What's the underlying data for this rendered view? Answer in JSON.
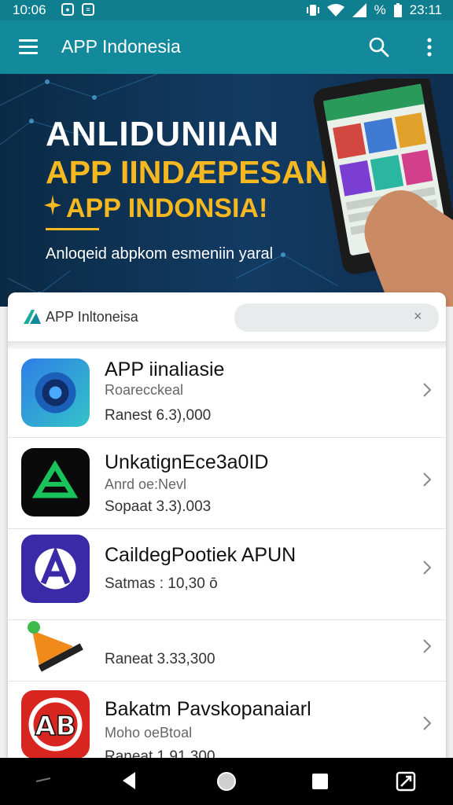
{
  "status_bar": {
    "time": "10:06",
    "battery": "%",
    "clock_right": "23:11"
  },
  "app_bar": {
    "title": "APP Indonesia"
  },
  "banner": {
    "line1": "ANLIDUNIIAN",
    "line2": "APP IINDÆPESAN",
    "line3": "APP INDONSIA!",
    "tagline": "Anloqeid abpkom esmeniin yaral"
  },
  "card": {
    "brand": "APP Inltoneisa",
    "search_placeholder": "",
    "clear_label": "×"
  },
  "apps": [
    {
      "title": "APP iinaliasie",
      "subtitle": "Roarecckeal",
      "price": "Ranest 6.3),000"
    },
    {
      "title": "UnkatignEce3a0ID",
      "subtitle": "Anrd oe:Nevl",
      "price": "Sopaat 3.3).003"
    },
    {
      "title": "CaildegPootiek APUN",
      "subtitle": "",
      "price": "Satmas : 10,30 ō"
    },
    {
      "title": "",
      "subtitle": "",
      "price": "Raneat 3.33,300"
    },
    {
      "title": "Bakatm Pavskopanaiarl",
      "subtitle": "Moho oeBtoal",
      "price": "Raneat 1.91,300"
    }
  ],
  "colors": {
    "accent": "#138a9b",
    "statusbar": "#0f7e8e",
    "banner_gold": "#f5b821"
  }
}
